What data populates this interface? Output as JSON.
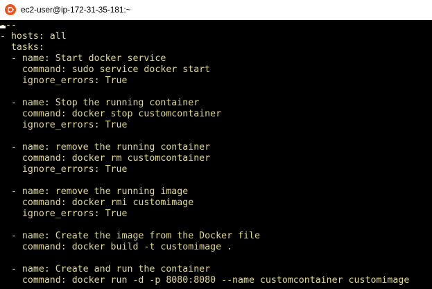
{
  "window": {
    "title": "ec2-user@ip-172-31-35-181:~",
    "icon": "ubuntu-logo-icon"
  },
  "colors": {
    "terminal_bg": "#000000",
    "terminal_text": "#e2d98e",
    "titlebar_bg": "#ffffff",
    "icon_accent": "#e95420"
  },
  "terminal": {
    "lines": [
      "---",
      "- hosts: all",
      "  tasks:",
      "  - name: Start docker service",
      "    command: sudo service docker start",
      "    ignore_errors: True",
      "",
      "  - name: Stop the running container",
      "    command: docker stop customcontainer",
      "    ignore_errors: True",
      "",
      "  - name: remove the running container",
      "    command: docker rm customcontainer",
      "    ignore_errors: True",
      "",
      "  - name: remove the running image",
      "    command: docker rmi customimage",
      "    ignore_errors: True",
      "",
      "  - name: Create the image from the Docker file",
      "    command: docker build -t customimage .",
      "",
      "  - name: Create and run the container",
      "    command: docker run -d -p 8080:8080 --name customcontainer customimage"
    ]
  }
}
